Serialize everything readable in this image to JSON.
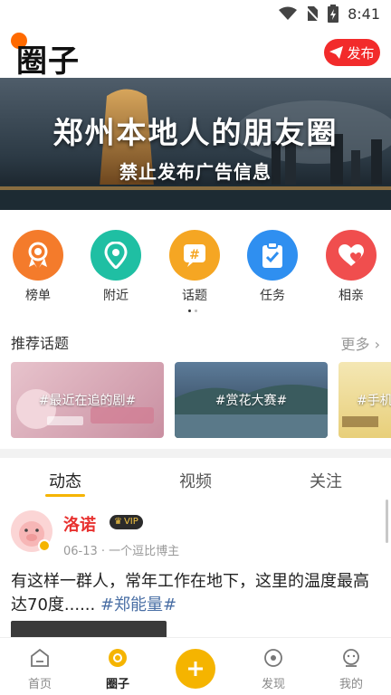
{
  "status_bar": {
    "time": "8:41"
  },
  "header": {
    "title": "圈子",
    "publish_label": "发布"
  },
  "banner": {
    "title": "郑州本地人的朋友圈",
    "subtitle": "禁止发布广告信息"
  },
  "quick_nav": [
    {
      "label": "榜单",
      "icon": "ribbon-icon",
      "color": "#f47b2b"
    },
    {
      "label": "附近",
      "icon": "location-pin-icon",
      "color": "#1fbfa3"
    },
    {
      "label": "话题",
      "icon": "hashtag-icon",
      "color": "#f5a623"
    },
    {
      "label": "任务",
      "icon": "clipboard-check-icon",
      "color": "#2f8ff0"
    },
    {
      "label": "相亲",
      "icon": "heart-icon",
      "color": "#f04e4e"
    }
  ],
  "recommend": {
    "title": "推荐话题",
    "more_label": "更多",
    "topics": [
      {
        "label": "#最近在追的剧#"
      },
      {
        "label": "#赏花大赛#"
      },
      {
        "label": "#手机"
      }
    ]
  },
  "tabs": [
    {
      "label": "动态",
      "active": true
    },
    {
      "label": "视频",
      "active": false
    },
    {
      "label": "关注",
      "active": false
    }
  ],
  "post": {
    "author": "洛诺",
    "vip_label": "VIP",
    "meta": "06-13 · 一个逗比博主",
    "body": "有这样一群人，常年工作在地下，这里的温度最高达70度......",
    "tag": "#郑能量#"
  },
  "bottom_nav": [
    {
      "label": "首页",
      "icon": "home-icon",
      "active": false
    },
    {
      "label": "圈子",
      "icon": "circle-icon",
      "active": true
    },
    {
      "label": "发现",
      "icon": "compass-icon",
      "active": false
    },
    {
      "label": "我的",
      "icon": "profile-icon",
      "active": false
    }
  ],
  "colors": {
    "accent": "#f5b400",
    "publish": "#f22b2b",
    "author": "#e8312f",
    "tag": "#4a6fa5"
  }
}
